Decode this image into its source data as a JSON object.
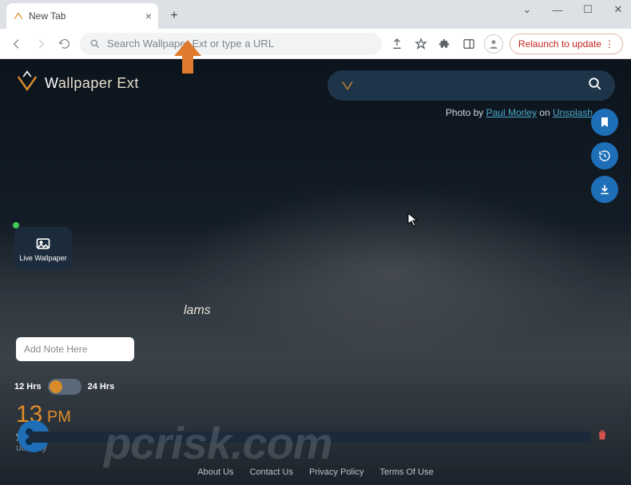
{
  "browser": {
    "tab_title": "New Tab",
    "omnibox_placeholder": "Search Wallpaper Ext or type a URL",
    "relaunch_label": "Relaunch to update"
  },
  "brand": {
    "prefix": "W",
    "suffix": "allpaper Ext"
  },
  "credit": {
    "prefix": "Photo by ",
    "author": "Paul Morley",
    "middle": " on ",
    "source": "Unsplash"
  },
  "live_wallpaper_label": "Live Wallpaper",
  "mid_text": "lams",
  "note_placeholder": "Add Note Here",
  "toggle": {
    "left": "12 Hrs",
    "right": "24 Hrs"
  },
  "clock": {
    "time": "13",
    "time_suffix": " PM",
    "date": "y 27, 2024",
    "day": "uesday"
  },
  "footer": {
    "about": "About Us",
    "contact": "Contact Us",
    "privacy": "Privacy Policy",
    "terms": "Terms Of Use"
  },
  "watermark": "pcrisk.com",
  "colors": {
    "accent": "#e18c2a",
    "primary": "#1e6fb8"
  }
}
